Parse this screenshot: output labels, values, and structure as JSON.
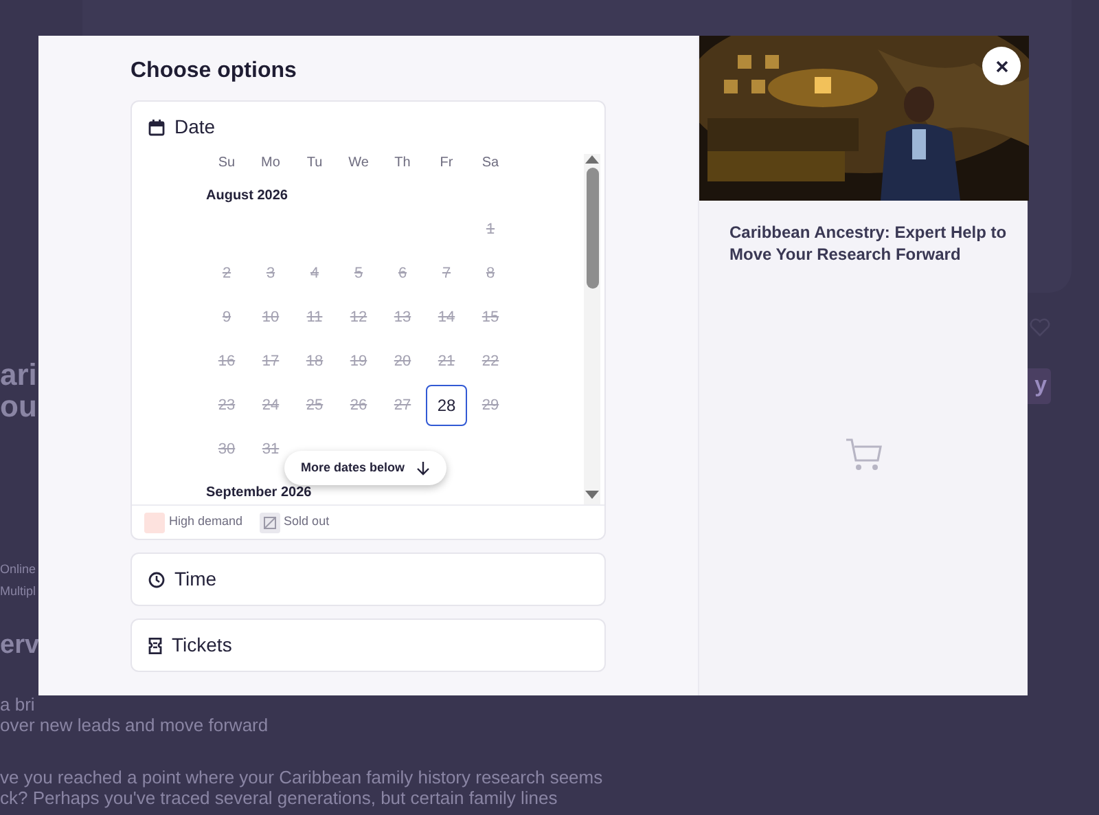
{
  "backdrop": {
    "heading_lines": [
      "ari",
      "ou"
    ],
    "meta_lines": [
      "Online",
      "Multipl"
    ],
    "section_heading": "erv",
    "intro_lines": [
      "a bri",
      "over new leads and move forward"
    ],
    "paragraph_lines": [
      "ve you reached a point where your Caribbean family history research seems",
      "ck? Perhaps you've traced several generations, but certain family lines"
    ],
    "button": "y"
  },
  "options": {
    "title": "Choose options",
    "date_section": {
      "label": "Date",
      "weekdays": [
        "Su",
        "Mo",
        "Tu",
        "We",
        "Th",
        "Fr",
        "Sa"
      ],
      "months": [
        {
          "name": "August 2026",
          "weeks": [
            [
              {
                "kind": "empty"
              },
              {
                "kind": "empty"
              },
              {
                "kind": "empty"
              },
              {
                "kind": "empty"
              },
              {
                "kind": "empty"
              },
              {
                "kind": "empty"
              },
              {
                "kind": "day",
                "day": "1",
                "sold_out": true,
                "selected": false
              }
            ],
            [
              {
                "kind": "day",
                "day": "2",
                "sold_out": true,
                "selected": false
              },
              {
                "kind": "day",
                "day": "3",
                "sold_out": true,
                "selected": false
              },
              {
                "kind": "day",
                "day": "4",
                "sold_out": true,
                "selected": false
              },
              {
                "kind": "day",
                "day": "5",
                "sold_out": true,
                "selected": false
              },
              {
                "kind": "day",
                "day": "6",
                "sold_out": true,
                "selected": false
              },
              {
                "kind": "day",
                "day": "7",
                "sold_out": true,
                "selected": false
              },
              {
                "kind": "day",
                "day": "8",
                "sold_out": true,
                "selected": false
              }
            ],
            [
              {
                "kind": "day",
                "day": "9",
                "sold_out": true,
                "selected": false
              },
              {
                "kind": "day",
                "day": "10",
                "sold_out": true,
                "selected": false
              },
              {
                "kind": "day",
                "day": "11",
                "sold_out": true,
                "selected": false
              },
              {
                "kind": "day",
                "day": "12",
                "sold_out": true,
                "selected": false
              },
              {
                "kind": "day",
                "day": "13",
                "sold_out": true,
                "selected": false
              },
              {
                "kind": "day",
                "day": "14",
                "sold_out": true,
                "selected": false
              },
              {
                "kind": "day",
                "day": "15",
                "sold_out": true,
                "selected": false
              }
            ],
            [
              {
                "kind": "day",
                "day": "16",
                "sold_out": true,
                "selected": false
              },
              {
                "kind": "day",
                "day": "17",
                "sold_out": true,
                "selected": false
              },
              {
                "kind": "day",
                "day": "18",
                "sold_out": true,
                "selected": false
              },
              {
                "kind": "day",
                "day": "19",
                "sold_out": true,
                "selected": false
              },
              {
                "kind": "day",
                "day": "20",
                "sold_out": true,
                "selected": false
              },
              {
                "kind": "day",
                "day": "21",
                "sold_out": true,
                "selected": false
              },
              {
                "kind": "day",
                "day": "22",
                "sold_out": true,
                "selected": false
              }
            ],
            [
              {
                "kind": "day",
                "day": "23",
                "sold_out": true,
                "selected": false
              },
              {
                "kind": "day",
                "day": "24",
                "sold_out": true,
                "selected": false
              },
              {
                "kind": "day",
                "day": "25",
                "sold_out": true,
                "selected": false
              },
              {
                "kind": "day",
                "day": "26",
                "sold_out": true,
                "selected": false
              },
              {
                "kind": "day",
                "day": "27",
                "sold_out": true,
                "selected": false
              },
              {
                "kind": "day",
                "day": "28",
                "sold_out": false,
                "selected": true
              },
              {
                "kind": "day",
                "day": "29",
                "sold_out": true,
                "selected": false
              }
            ],
            [
              {
                "kind": "day",
                "day": "30",
                "sold_out": true,
                "selected": false
              },
              {
                "kind": "day",
                "day": "31",
                "sold_out": true,
                "selected": false
              }
            ]
          ]
        },
        {
          "name": "September 2026"
        }
      ],
      "more_dates": "More dates below",
      "legend": [
        {
          "kind": "high_demand",
          "label": "High demand"
        },
        {
          "kind": "sold_out",
          "label": "Sold out"
        }
      ]
    },
    "sections": [
      {
        "kind": "time",
        "label": "Time"
      },
      {
        "kind": "tickets",
        "label": "Tickets"
      }
    ]
  },
  "product": {
    "title": "Caribbean Ancestry: Expert Help to Move Your Research Forward"
  }
}
